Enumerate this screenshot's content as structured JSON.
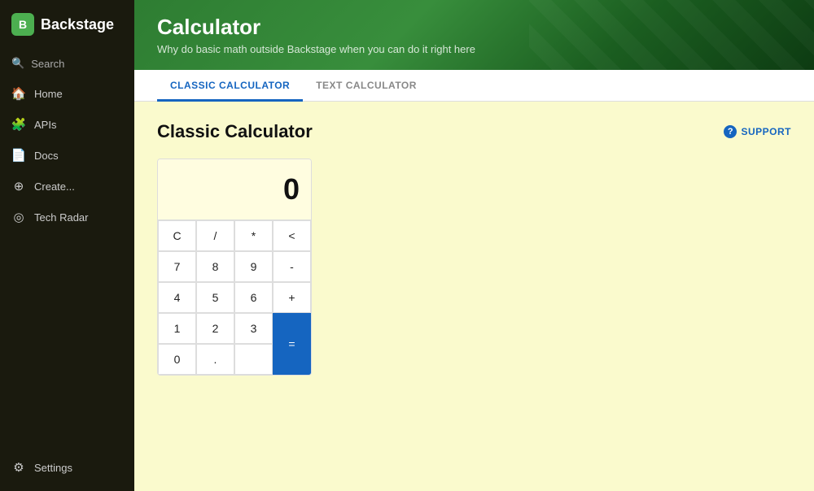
{
  "sidebar": {
    "logo_text": "Backstage",
    "search_label": "Search",
    "items": [
      {
        "id": "home",
        "label": "Home",
        "icon": "🏠"
      },
      {
        "id": "apis",
        "label": "APIs",
        "icon": "🧩"
      },
      {
        "id": "docs",
        "label": "Docs",
        "icon": "📄"
      },
      {
        "id": "create",
        "label": "Create...",
        "icon": "⊕"
      },
      {
        "id": "tech-radar",
        "label": "Tech Radar",
        "icon": "◎"
      }
    ],
    "bottom_items": [
      {
        "id": "settings",
        "label": "Settings",
        "icon": "⚙"
      }
    ]
  },
  "header": {
    "title": "Calculator",
    "subtitle": "Why do basic math outside Backstage when you can do it right here"
  },
  "tabs": [
    {
      "id": "classic",
      "label": "CLASSIC CALCULATOR",
      "active": true
    },
    {
      "id": "text",
      "label": "TEXT CALCULATOR",
      "active": false
    }
  ],
  "content": {
    "calculator_title": "Classic Calculator",
    "support_label": "SUPPORT",
    "display_value": "0"
  },
  "calculator": {
    "buttons": [
      {
        "label": "C",
        "type": "function"
      },
      {
        "label": "/",
        "type": "operator"
      },
      {
        "label": "*",
        "type": "operator"
      },
      {
        "label": "<",
        "type": "function"
      },
      {
        "label": "7",
        "type": "number"
      },
      {
        "label": "8",
        "type": "number"
      },
      {
        "label": "9",
        "type": "number"
      },
      {
        "label": "-",
        "type": "operator"
      },
      {
        "label": "4",
        "type": "number"
      },
      {
        "label": "5",
        "type": "number"
      },
      {
        "label": "6",
        "type": "number"
      },
      {
        "label": "+",
        "type": "operator"
      },
      {
        "label": "1",
        "type": "number"
      },
      {
        "label": "2",
        "type": "number"
      },
      {
        "label": "3",
        "type": "number"
      },
      {
        "label": "=",
        "type": "equals"
      },
      {
        "label": "0",
        "type": "number"
      },
      {
        "label": ".",
        "type": "number"
      }
    ]
  }
}
